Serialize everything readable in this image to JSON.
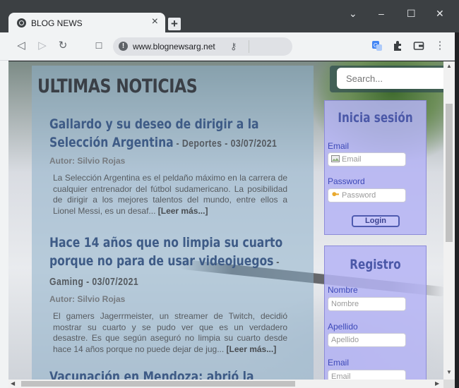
{
  "browser": {
    "tab_title": "BLOG NEWS",
    "tab_close": "×",
    "new_tab": "+",
    "url": "www.blognewsarg.net",
    "window_controls": {
      "menu": "⌄",
      "minimize": "–",
      "maximize": "☐",
      "close": "✕"
    },
    "nav": {
      "back": "◁",
      "forward": "▷",
      "reload": "↻",
      "bookmark": "☐",
      "menu": "⋮"
    }
  },
  "page": {
    "title": "ULTIMAS NOTICIAS",
    "articles": [
      {
        "headline": "Gallardo y su deseo de dirigir a la Selección Argentina",
        "meta": " - Deportes - 03/07/2021",
        "author": "Autor: Silvio Rojas",
        "excerpt": "La Selección Argentina es el peldaño máximo en la carrera de cualquier entrenador del fútbol sudamericano. La posibilidad de dirigir a los mejores talentos del mundo, entre ellos a Lionel Messi, es un desaf... ",
        "readmore": "[Leer más...]"
      },
      {
        "headline": "Hace 14 años que no limpia su cuarto porque no para de usar videojuegos",
        "meta": " - Gaming - 03/07/2021",
        "author": "Autor: Silvio Rojas",
        "excerpt": "El gamers Jagerrmeister, un streamer de Twitch, decidió mostrar su cuarto y se pudo ver que es un verdadero desastre. Es que según aseguró no limpia su cuarto desde hace 14 años porque no puede dejar de jug... ",
        "readmore": "[Leer más...]"
      },
      {
        "headline": "Vacunación en Mendoza: abrió la inscripción"
      }
    ]
  },
  "sidebar": {
    "search_placeholder": "Search...",
    "login": {
      "title": "Inicia sesión",
      "email_label": "Email",
      "email_placeholder": "Email",
      "password_label": "Password",
      "password_placeholder": "Password",
      "button": "Login"
    },
    "register": {
      "title": "Registro",
      "name_label": "Nombre",
      "name_placeholder": "Nombre",
      "surname_label": "Apellido",
      "surname_placeholder": "Apellido",
      "email_label": "Email",
      "email_placeholder": "Email"
    }
  },
  "colors": {
    "headline": "#3e5b86",
    "side_box": "#b5b4f5",
    "side_label": "#3d49b8"
  }
}
